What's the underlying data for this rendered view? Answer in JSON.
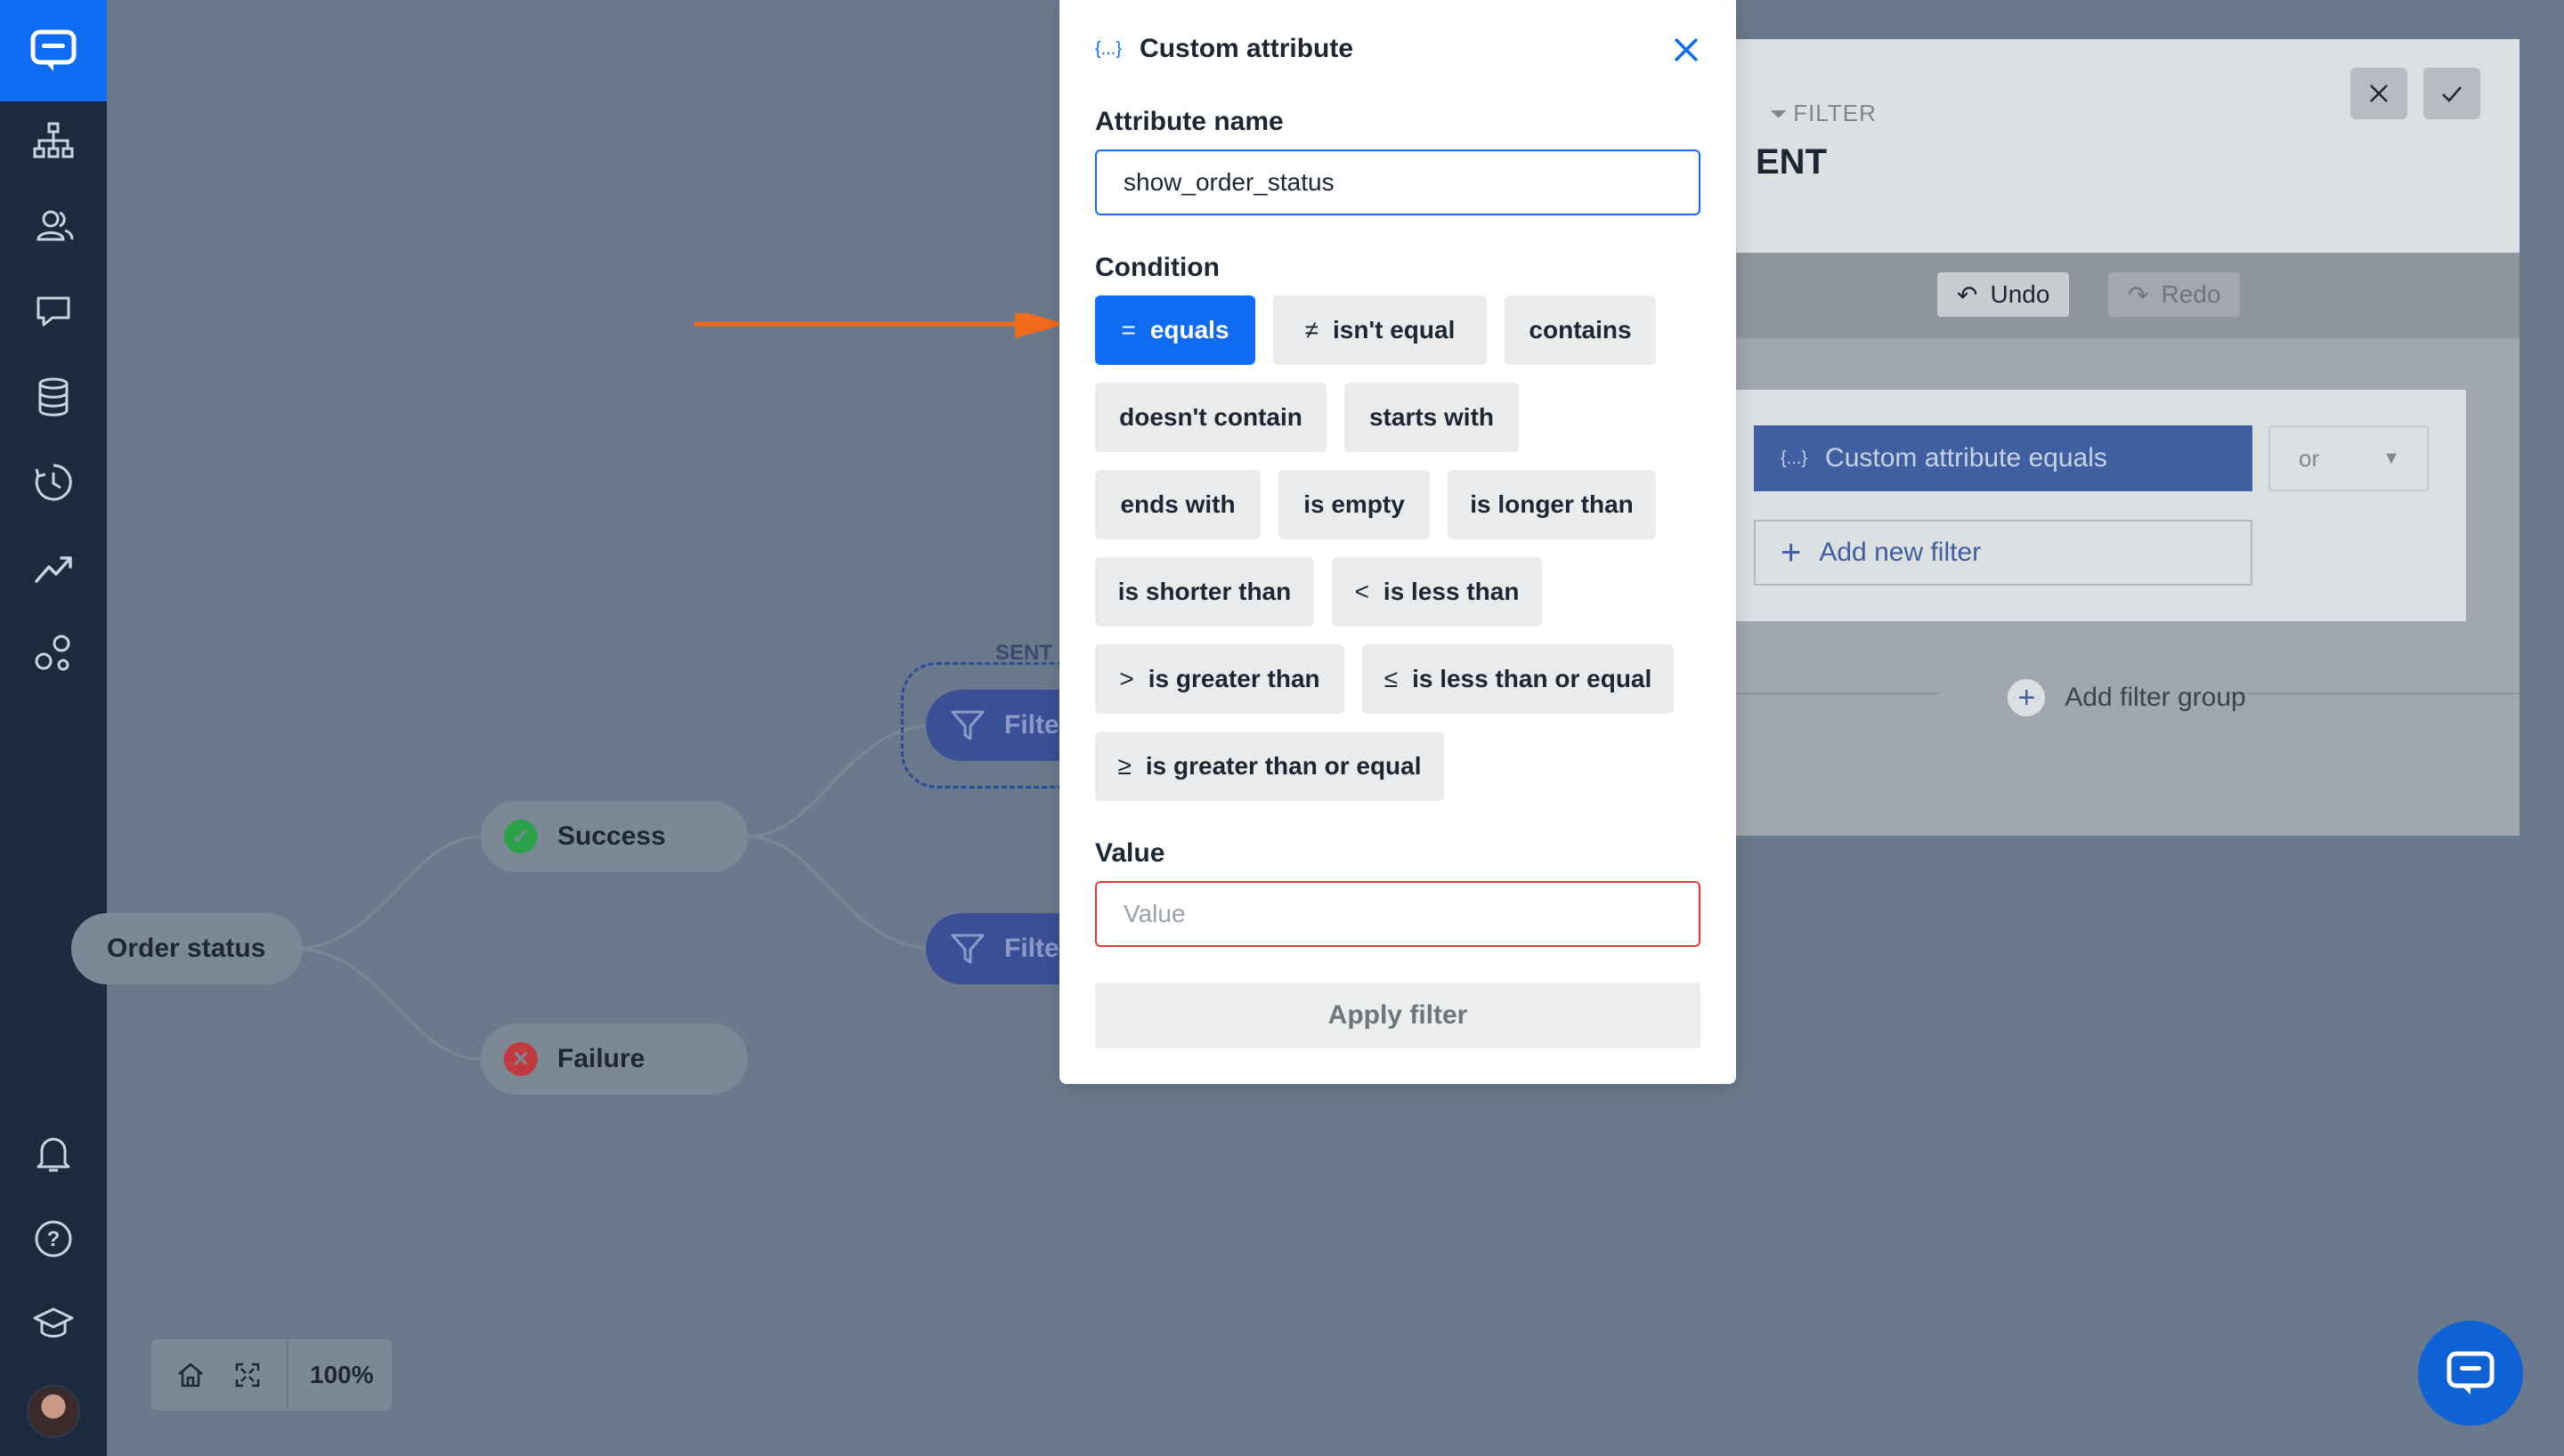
{
  "sidebar": {
    "items": [
      "org-chart-icon",
      "contacts-icon",
      "chats-icon",
      "database-icon",
      "history-icon",
      "analytics-icon",
      "integrations-icon"
    ],
    "bottom_items": [
      "notifications-icon",
      "help-icon",
      "academy-icon"
    ]
  },
  "canvas": {
    "nodes": {
      "order_status": "Order status",
      "success": "Success",
      "failure": "Failure",
      "filter_top": "Filte",
      "filter_bottom": "Filte",
      "sent": "SENT"
    },
    "zoom": "100%"
  },
  "right_panel": {
    "filter_label": "FILTER",
    "title_fragment": "ENT",
    "undo": "Undo",
    "redo": "Redo",
    "condition_pill": "Custom attribute equals",
    "or_select": "or",
    "add_filter": "Add new filter",
    "add_group": "Add filter group"
  },
  "modal": {
    "title": "Custom attribute",
    "attribute_label": "Attribute name",
    "attribute_value": "show_order_status",
    "condition_label": "Condition",
    "conditions": [
      {
        "sym": "=",
        "label": "equals",
        "active": true
      },
      {
        "sym": "≠",
        "label": "isn't equal"
      },
      {
        "sym": "",
        "label": "contains"
      },
      {
        "sym": "",
        "label": "doesn't contain"
      },
      {
        "sym": "",
        "label": "starts with"
      },
      {
        "sym": "",
        "label": "ends with"
      },
      {
        "sym": "",
        "label": "is empty"
      },
      {
        "sym": "",
        "label": "is longer than"
      },
      {
        "sym": "",
        "label": "is shorter than"
      },
      {
        "sym": "<",
        "label": "is less than"
      },
      {
        "sym": ">",
        "label": "is greater than"
      },
      {
        "sym": "≤",
        "label": "is less than or equal"
      },
      {
        "sym": "≥",
        "label": "is greater than or equal"
      }
    ],
    "value_label": "Value",
    "value_placeholder": "Value",
    "apply": "Apply filter"
  },
  "colors": {
    "primary": "#0e6bf2",
    "sidebar": "#1b2a3d",
    "error": "#e8393a",
    "arrow": "#f26b1d"
  }
}
